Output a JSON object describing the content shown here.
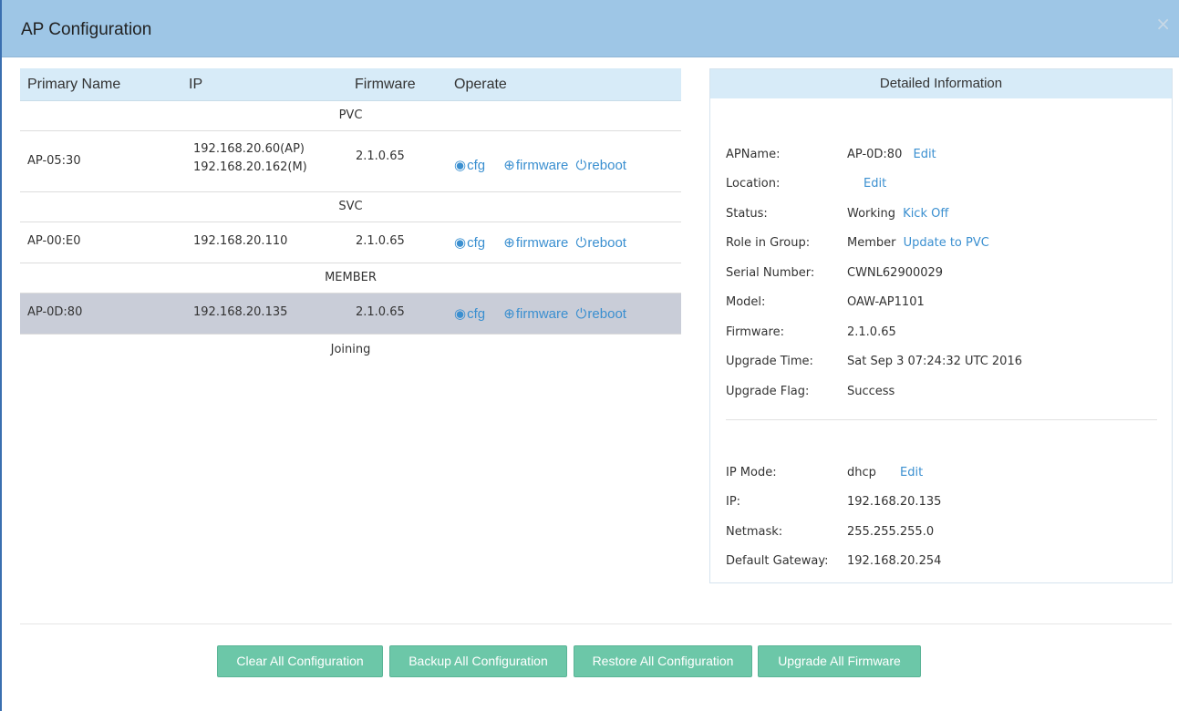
{
  "dialog": {
    "title": "AP Configuration",
    "close": "×"
  },
  "table": {
    "headers": {
      "name": "Primary Name",
      "ip": "IP",
      "firmware": "Firmware",
      "operate": "Operate"
    },
    "groups": {
      "pvc": "PVC",
      "svc": "SVC",
      "member": "MEMBER",
      "joining": "Joining"
    },
    "rows": [
      {
        "name": "AP-05:30",
        "ip1": "192.168.20.60(AP)",
        "ip2": "192.168.20.162(M)",
        "firmware": "2.1.0.65"
      },
      {
        "name": "AP-00:E0",
        "ip1": "192.168.20.110",
        "firmware": "2.1.0.65"
      },
      {
        "name": "AP-0D:80",
        "ip1": "192.168.20.135",
        "firmware": "2.1.0.65"
      }
    ],
    "ops": {
      "cfg": "cfg",
      "firmware": "firmware",
      "reboot": "reboot",
      "cfg_icon": "◉",
      "firmware_icon": "⊕",
      "reboot_icon": "⏻"
    }
  },
  "detail": {
    "title": "Detailed Information",
    "apname": {
      "label": "APName:",
      "value": "AP-0D:80",
      "action": "Edit"
    },
    "location": {
      "label": "Location:",
      "action": "Edit"
    },
    "status": {
      "label": "Status:",
      "value": "Working",
      "action": "Kick Off"
    },
    "role": {
      "label": "Role in Group:",
      "value": "Member",
      "action": "Update to PVC"
    },
    "serial": {
      "label": "Serial Number:",
      "value": "CWNL62900029"
    },
    "model": {
      "label": "Model:",
      "value": "OAW-AP1101"
    },
    "firmware": {
      "label": "Firmware:",
      "value": "2.1.0.65"
    },
    "upgrade_time": {
      "label": "Upgrade Time:",
      "value": "Sat Sep 3 07:24:32 UTC 2016"
    },
    "upgrade_flag": {
      "label": "Upgrade Flag:",
      "value": "Success"
    },
    "ip_mode": {
      "label": "IP Mode:",
      "value": "dhcp",
      "action": "Edit"
    },
    "ip": {
      "label": "IP:",
      "value": "192.168.20.135"
    },
    "netmask": {
      "label": "Netmask:",
      "value": "255.255.255.0"
    },
    "gateway": {
      "label": "Default Gateway:",
      "value": "192.168.20.254"
    }
  },
  "buttons": {
    "clear": "Clear All Configuration",
    "backup": "Backup All Configuration",
    "restore": "Restore All Configuration",
    "upgrade": "Upgrade All Firmware"
  },
  "colors": {
    "header": "#9ec6e6",
    "table_header": "#d7ebf8",
    "link": "#3a8fd0",
    "button": "#6cc7a8",
    "selected_row": "#c9cdd8"
  }
}
